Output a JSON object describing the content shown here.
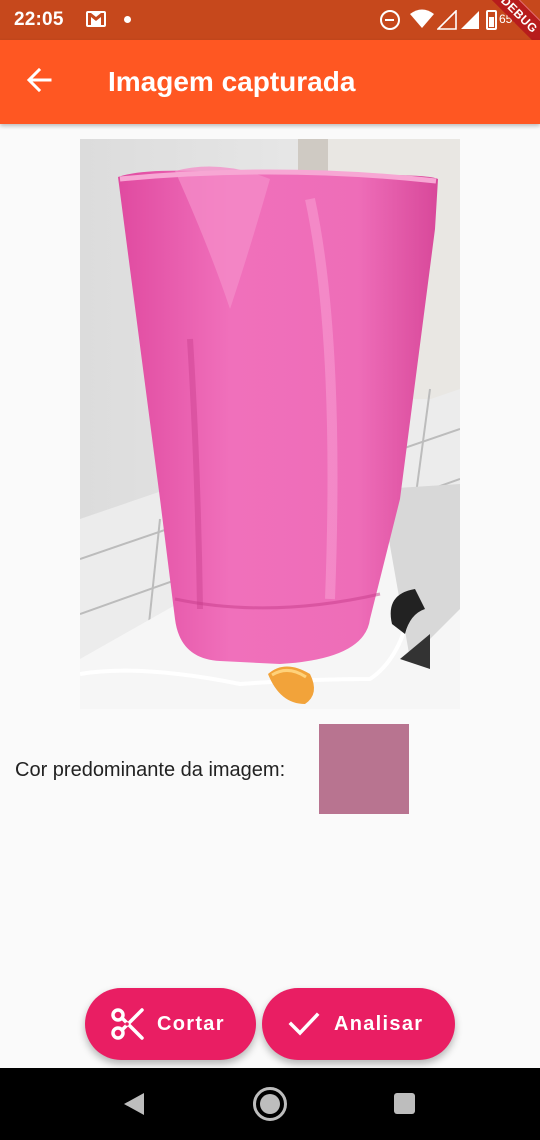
{
  "status_bar": {
    "time": "22:05",
    "battery_percent": "65%",
    "battery_level": 0.65,
    "icons": [
      "gmail-icon",
      "notification-dot-icon",
      "do-not-disturb-icon",
      "wifi-icon",
      "signal-icon",
      "signal-icon",
      "battery-icon"
    ]
  },
  "debug_banner": {
    "label": "DEBUG"
  },
  "app_bar": {
    "title": "Imagem capturada",
    "back_icon": "arrow-back-icon",
    "color": "#ff5722"
  },
  "photo": {
    "subject": "pink plastic pitcher"
  },
  "dominant_color": {
    "label": "Cor predominante da imagem:",
    "swatch_color": "#b87490"
  },
  "actions": {
    "crop": {
      "label": "Cortar",
      "icon": "scissors-icon"
    },
    "analyze": {
      "label": "Analisar",
      "icon": "check-icon"
    },
    "color": "#e91e63"
  },
  "nav_bar": {
    "icons": [
      "back-triangle-icon",
      "home-circle-icon",
      "recents-square-icon"
    ]
  }
}
